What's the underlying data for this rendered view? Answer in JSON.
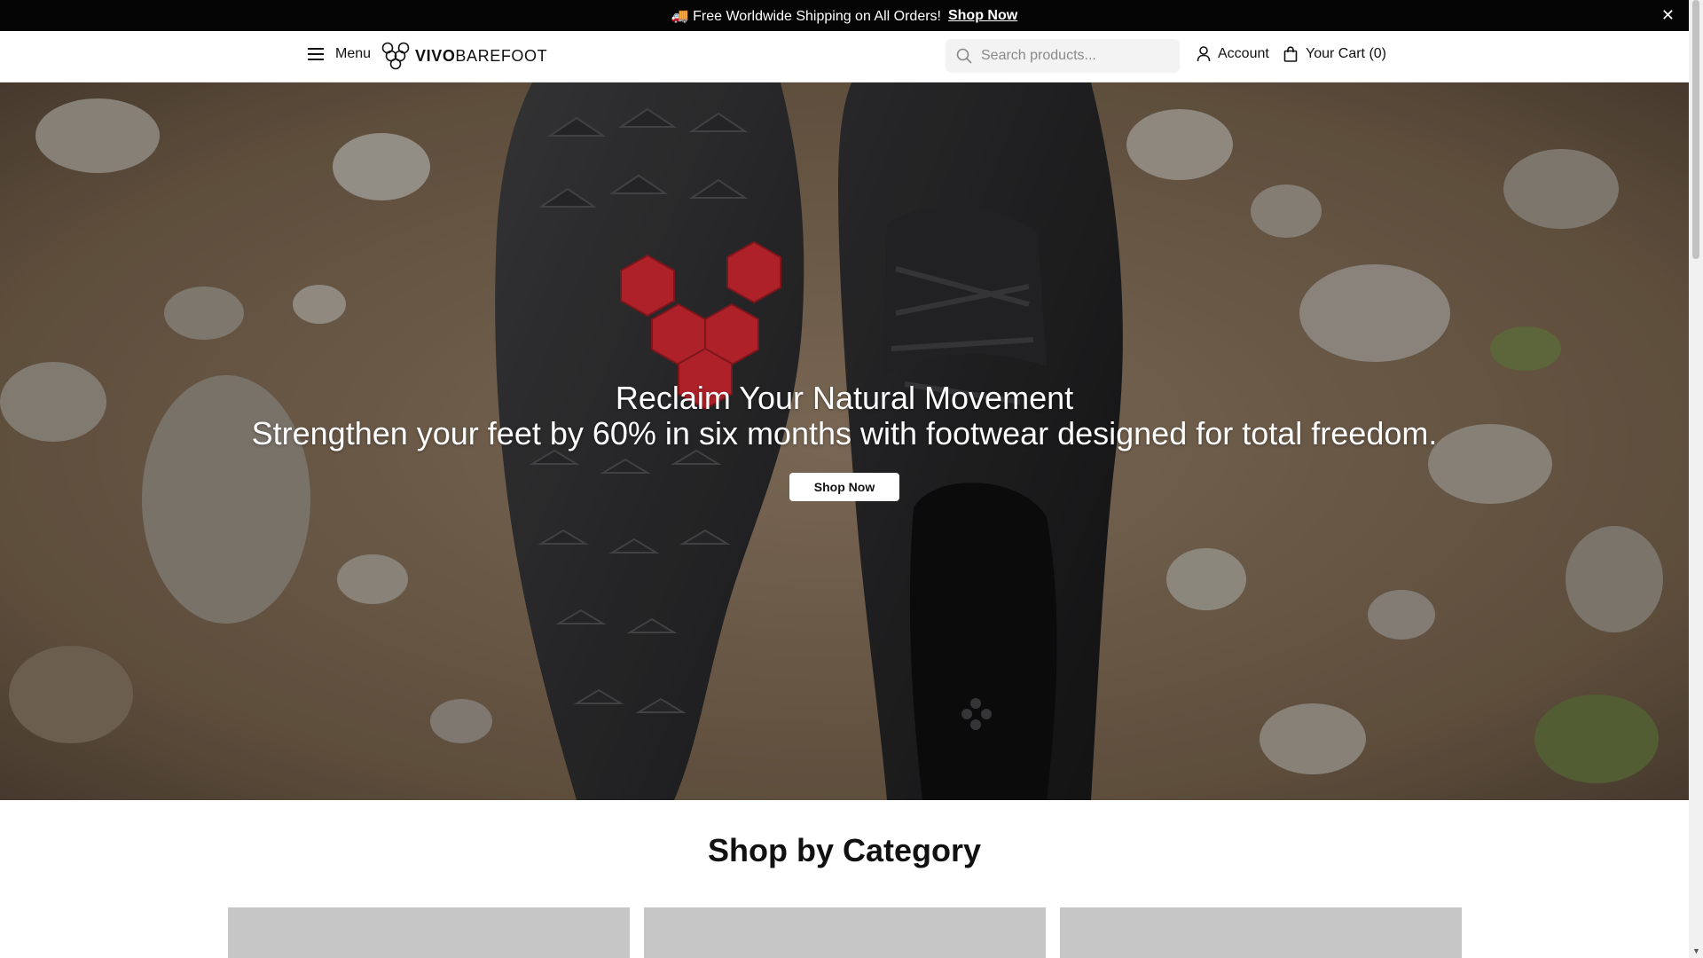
{
  "announcement": {
    "icon": "truck-icon",
    "text": "🚚 Free Worldwide Shipping on All Orders!",
    "link": "Shop Now",
    "close": "✕"
  },
  "header": {
    "menu_label": "Menu",
    "logo_text_bold": "VIVO",
    "logo_text_light": "BAREFOOT",
    "search_placeholder": "Search products...",
    "account_label": "Account",
    "cart_label": "Your Cart (0)"
  },
  "hero": {
    "title": "Reclaim Your Natural Movement",
    "subtitle": "Strengthen your feet by 60% in six months with footwear designed for total freedom.",
    "button_label": "Shop Now"
  },
  "category": {
    "title": "Shop by Category"
  },
  "colors": {
    "announcement_bg": "#050505",
    "accent_red": "#c8262f",
    "card_placeholder": "#c6c6c6"
  }
}
